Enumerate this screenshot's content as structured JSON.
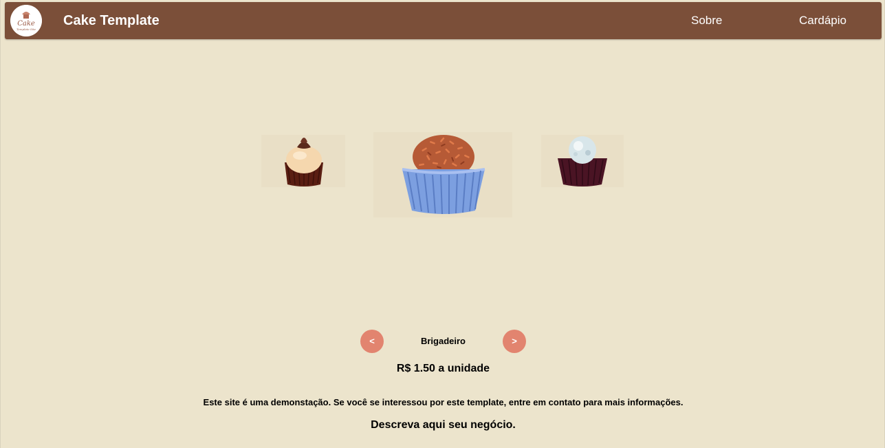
{
  "navbar": {
    "logo": {
      "text_main": "Cake",
      "text_sub": "Template Site"
    },
    "title": "Cake Template",
    "links": [
      {
        "label": "Sobre"
      },
      {
        "label": "Cardápio"
      }
    ]
  },
  "carousel": {
    "items": [
      {
        "image": "cream-truffle-chocolate-cup"
      },
      {
        "image": "brigadeiro-blue-cup"
      },
      {
        "image": "coconut-truffle-dark-cup"
      }
    ],
    "prev_label": "<",
    "next_label": ">",
    "current_name": "Brigadeiro",
    "price_text": "R$ 1.50 a unidade"
  },
  "footer": {
    "notice": "Este site é uma demonstação. Se você se interessou por este template, entre em contato para mais informações.",
    "describe": "Descreva aqui seu negócio."
  },
  "colors": {
    "background": "#ECE4CC",
    "navbar": "#7B4F39",
    "button": "#E2846F"
  }
}
